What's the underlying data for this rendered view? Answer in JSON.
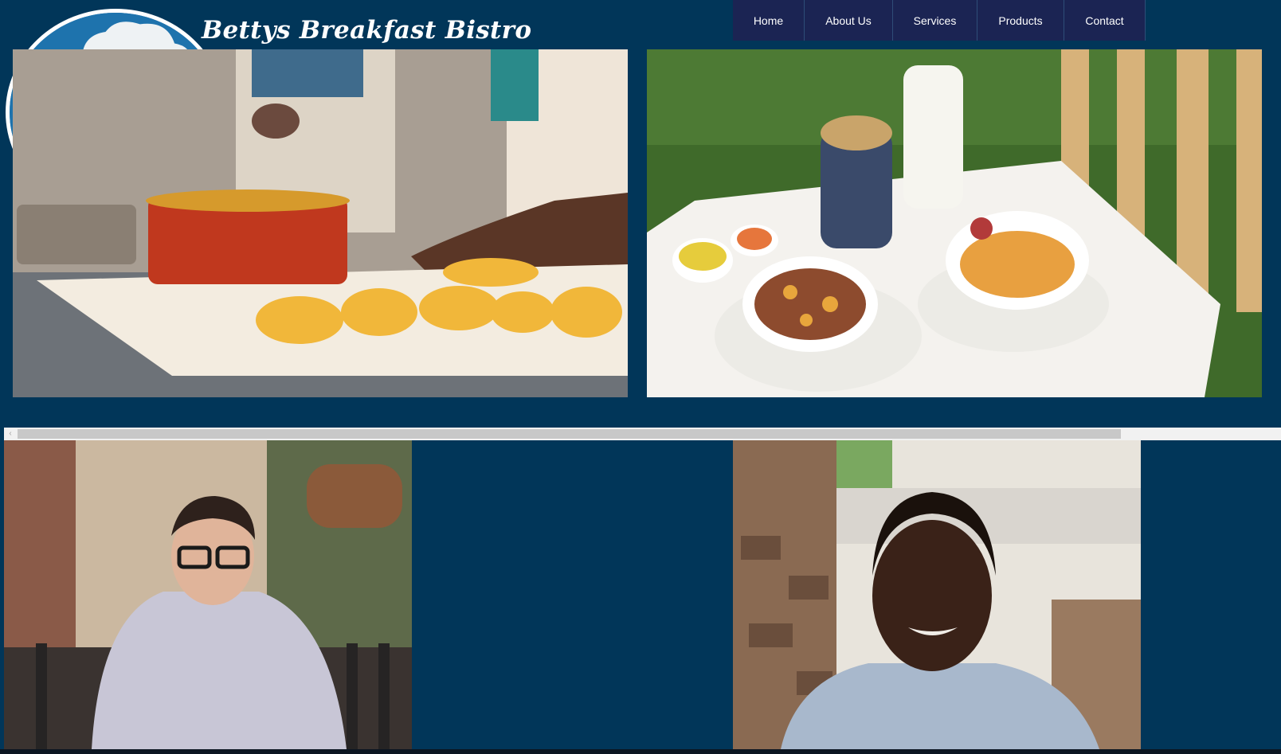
{
  "site": {
    "title": "Bettys Breakfast Bistro"
  },
  "nav": {
    "items": [
      {
        "label": "Home"
      },
      {
        "label": "About Us"
      },
      {
        "label": "Services"
      },
      {
        "label": "Products"
      },
      {
        "label": "Contact"
      }
    ]
  },
  "logo": {
    "icon": "chef-portrait-icon"
  },
  "scrollbar": {
    "left_arrow_icon": "‹"
  },
  "colors": {
    "page_background": "#013659",
    "nav_background": "#1b2453",
    "nav_divider": "#2e4d78",
    "logo_background": "#1e73ad",
    "title_color": "#ffffff"
  }
}
